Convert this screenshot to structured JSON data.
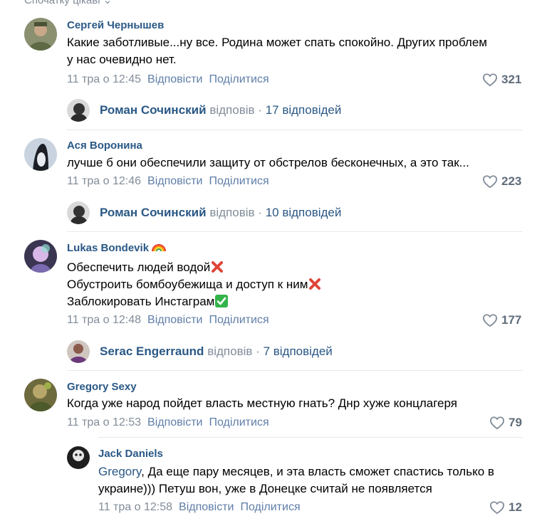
{
  "top": {
    "sort_label": "Спочатку цікаві"
  },
  "comments": [
    {
      "author": "Сергей Чернышев",
      "lines": [
        "Какие заботливые...ну все. Родина может спать спокойно. Других проблем",
        "у нас очевидно нет."
      ],
      "date": "11 тра о 12:45",
      "reply": "Відповісти",
      "share": "Поділитися",
      "likes": "321",
      "thread": {
        "name": "Роман Сочинский",
        "verb": "відповів",
        "dot": "·",
        "count": "17 відповідей"
      }
    },
    {
      "author": "Ася Воронина",
      "lines": [
        "лучше б они обеспечили защиту от обстрелов бесконечных, а это так..."
      ],
      "date": "11 тра о 12:46",
      "reply": "Відповісти",
      "share": "Поділитися",
      "likes": "223",
      "thread": {
        "name": "Роман Сочинский",
        "verb": "відповів",
        "dot": "·",
        "count": "10 відповідей"
      }
    },
    {
      "author": "Lukas Bondevik",
      "lines": [
        "Обеспечить людей водой",
        "Обустроить бомбоубежища и доступ к ним",
        "Заблокировать Инстаграм"
      ],
      "date": "11 тра о 12:48",
      "reply": "Відповісти",
      "share": "Поділитися",
      "likes": "177",
      "thread": {
        "name": "Serac Engerraund",
        "verb": "відповів",
        "dot": "·",
        "count": "7 відповідей"
      }
    },
    {
      "author": "Gregory Sexy",
      "lines": [
        "Когда уже народ пойдет власть местную гнать? Днр хуже концлагеря"
      ],
      "date": "11 тра о 12:53",
      "reply": "Відповісти",
      "share": "Поділитися",
      "likes": "79"
    }
  ],
  "nested_reply": {
    "author": "Jack Daniels",
    "reply_to": "Gregory",
    "line1_rest": ", Да еще пару месяцев, и эта власть сможет спастись только в",
    "line2": "украине))) Петуш вон, уже в Донецке считай не появляется",
    "date": "11 тра о 12:58",
    "reply": "Відповісти",
    "share": "Поділитися",
    "likes": "12"
  },
  "colors": {
    "link": "#2a5885",
    "meta": "#818c99",
    "action": "#5f7ea8",
    "separator": "#e7e8ec"
  },
  "icons": [
    "heart-icon",
    "rainbow-emoji",
    "cross-mark-emoji",
    "check-mark-emoji"
  ]
}
